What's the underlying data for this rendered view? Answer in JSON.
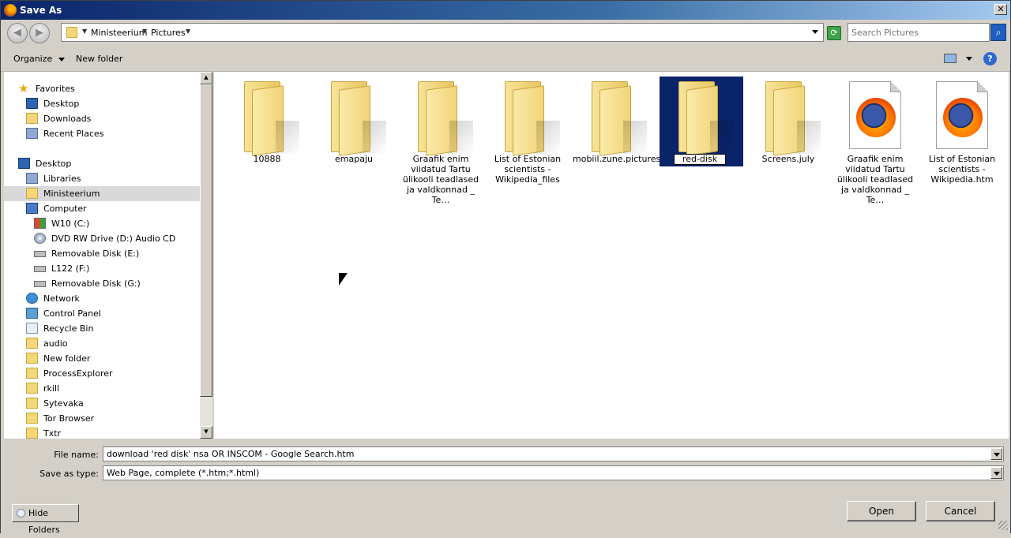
{
  "window": {
    "title": "Save As",
    "close_label": "✕"
  },
  "address": {
    "segments": [
      "Ministeerium",
      "Pictures"
    ],
    "search_placeholder": "Search Pictures"
  },
  "toolbar": {
    "organize_label": "Organize",
    "new_folder_label": "New folder",
    "help_label": "?"
  },
  "nav": {
    "items": [
      {
        "label": "Favorites",
        "icon": "star-icon"
      },
      {
        "label": "Desktop",
        "icon": "desktop-icon"
      },
      {
        "label": "Downloads",
        "icon": "downloads-folder-icon"
      },
      {
        "label": "Recent Places",
        "icon": "recent-places-icon"
      },
      {
        "label": "Desktop",
        "icon": "desktop-icon"
      },
      {
        "label": "Libraries",
        "icon": "libraries-icon"
      },
      {
        "label": "Ministeerium",
        "icon": "user-folder-icon"
      },
      {
        "label": "Computer",
        "icon": "computer-icon"
      },
      {
        "label": "W10 (C:)",
        "icon": "system-drive-icon"
      },
      {
        "label": "DVD RW Drive (D:) Audio CD",
        "icon": "cd-drive-icon"
      },
      {
        "label": "Removable Disk (E:)",
        "icon": "removable-drive-icon"
      },
      {
        "label": "L122 (F:)",
        "icon": "drive-icon"
      },
      {
        "label": "Removable Disk (G:)",
        "icon": "removable-drive-icon"
      },
      {
        "label": "Network",
        "icon": "network-icon"
      },
      {
        "label": "Control Panel",
        "icon": "control-panel-icon"
      },
      {
        "label": "Recycle Bin",
        "icon": "recycle-bin-icon"
      },
      {
        "label": "audio",
        "icon": "folder-icon"
      },
      {
        "label": "New folder",
        "icon": "folder-icon"
      },
      {
        "label": "ProcessExplorer",
        "icon": "folder-icon"
      },
      {
        "label": "rkill",
        "icon": "folder-icon"
      },
      {
        "label": "Sytevaka",
        "icon": "folder-icon"
      },
      {
        "label": "Tor Browser",
        "icon": "folder-icon"
      },
      {
        "label": "Txtr",
        "icon": "folder-icon"
      }
    ],
    "selected": "Ministeerium"
  },
  "files": [
    {
      "name": "10888",
      "type": "folder"
    },
    {
      "name": "emapaju",
      "type": "folder"
    },
    {
      "name": "Graafik  enim viidatud Tartu ülikooli teadlased ja valdkonnad _ Te…",
      "type": "folder"
    },
    {
      "name": "List of Estonian scientists - Wikipedia_files",
      "type": "folder"
    },
    {
      "name": "mobiil.zune.pictures",
      "type": "folder"
    },
    {
      "name": "red-disk",
      "type": "folder",
      "state": "renaming"
    },
    {
      "name": "Screens.july",
      "type": "folder"
    },
    {
      "name": "Graafik  enim viidatud Tartu ülikooli teadlased ja valdkonnad _ Te…",
      "type": "htm"
    },
    {
      "name": "List of Estonian scientists - Wikipedia.htm",
      "type": "htm"
    }
  ],
  "form": {
    "file_name_label": "File name:",
    "file_name_value": "download 'red disk' nsa OR INSCOM - Google Search.htm",
    "save_type_label": "Save as type:",
    "save_type_value": "Web Page, complete (*.htm;*.html)"
  },
  "buttons": {
    "open": "Open",
    "cancel": "Cancel",
    "hide_folders": "Hide Folders"
  },
  "colors": {
    "selection": "#0a246a",
    "folder": "#f3d778",
    "face": "#d4d0c8"
  }
}
